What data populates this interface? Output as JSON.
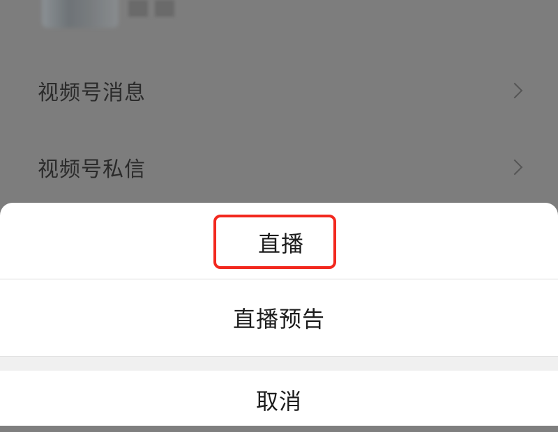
{
  "background_list": {
    "items": [
      {
        "label": "视频号消息"
      },
      {
        "label": "视频号私信"
      }
    ]
  },
  "action_sheet": {
    "options": [
      {
        "label": "直播"
      },
      {
        "label": "直播预告"
      }
    ],
    "cancel_label": "取消"
  },
  "colors": {
    "overlay": "#7d7d7d",
    "sheet_background": "#ffffff",
    "highlight": "#f2281e"
  },
  "icons": {
    "chevron": "chevron-right-icon"
  }
}
